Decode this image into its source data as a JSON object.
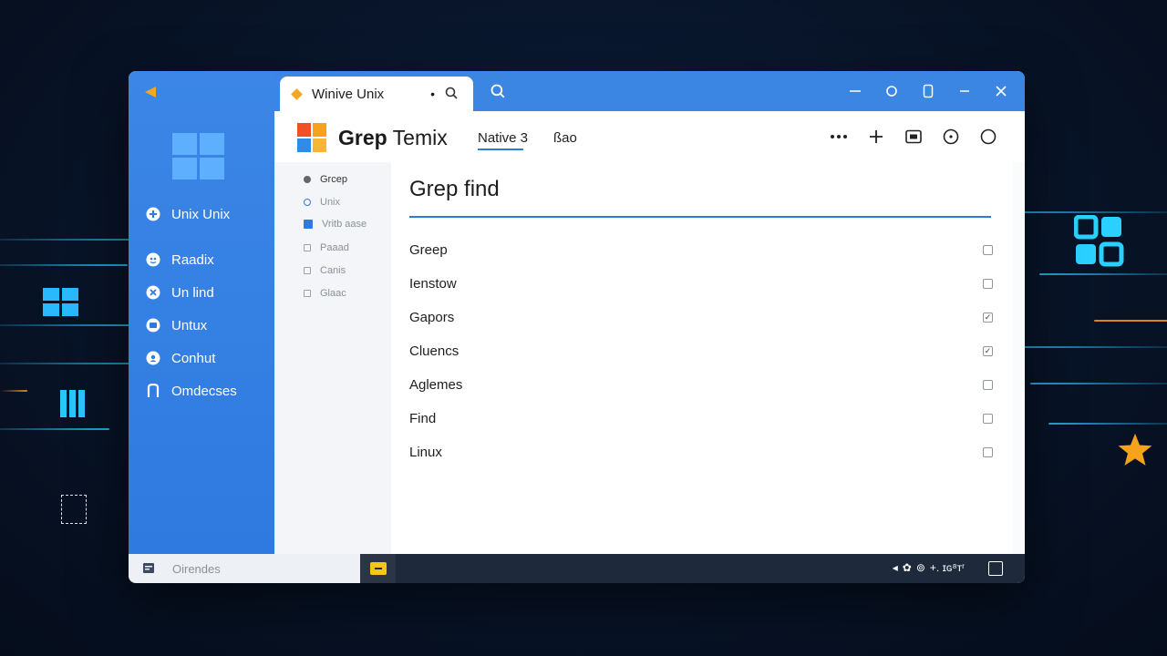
{
  "window": {
    "tab_title": "Winive Unix",
    "tab_dot": "•"
  },
  "nav_left": [
    {
      "label": "Unix Unix",
      "icon": "plus-circle-icon"
    },
    {
      "label": "Raadix",
      "icon": "globe-icon"
    },
    {
      "label": "Un lind",
      "icon": "close-circle-icon"
    },
    {
      "label": "Untux",
      "icon": "folder-icon"
    },
    {
      "label": "Conhut",
      "icon": "contacts-icon"
    },
    {
      "label": "Omdecses",
      "icon": "command-icon"
    }
  ],
  "header": {
    "app_title_bold": "Grep",
    "app_title_rest": " Temix",
    "nav_tab_active": "Native 3",
    "nav_tab_2": "ßao"
  },
  "sidebar2": [
    {
      "label": "Grcep"
    },
    {
      "label": "Unix"
    },
    {
      "label": "Vritb aase"
    },
    {
      "label": "Paaad"
    },
    {
      "label": "Canis"
    },
    {
      "label": "Glaac"
    }
  ],
  "content": {
    "title": "Grep find",
    "rows": [
      {
        "label": "Greep",
        "checked": false
      },
      {
        "label": "Ienstow",
        "checked": false
      },
      {
        "label": "Gapors",
        "checked": true
      },
      {
        "label": "Cluencs",
        "checked": true
      },
      {
        "label": "Aglemes",
        "checked": false
      },
      {
        "label": "Find",
        "checked": false
      },
      {
        "label": "Linux",
        "checked": false
      }
    ]
  },
  "statusbar": {
    "input_value": "Oirendes",
    "tray_text": "+. ɪɢ⁸ᴛʳ"
  },
  "colors": {
    "accent": "#2f7ae0",
    "titlebar": "#3a86e2",
    "background": "#081428",
    "diamond": "#f5a623"
  }
}
